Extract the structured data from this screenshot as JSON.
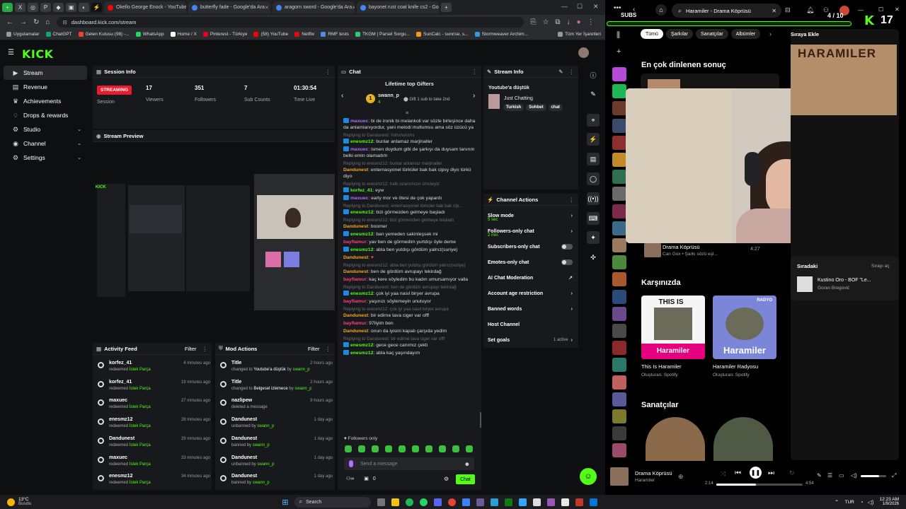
{
  "browser": {
    "tabs": [
      {
        "title": "Okello George Enock - YouTube",
        "color": "#ff0000"
      },
      {
        "title": "butterfly fade - Google'da Ara",
        "color": "#4285f4"
      },
      {
        "title": "aragorn sword - Google'da Ara",
        "color": "#4285f4"
      },
      {
        "title": "bayonet rust coat knife cs2 - Go",
        "color": "#4285f4"
      }
    ],
    "url": "dashboard.kick.com/stream",
    "bookmarks": [
      "Uygulamalar",
      "ChatGPT",
      "Gelen Kutusu (98) -...",
      "WhatsApp",
      "Home / X",
      "Pinterest - Türkiye",
      "(58) YouTube",
      "Netflix",
      "RMF tests",
      "TKGM | Parsel Sorgu...",
      "SunCalc - sunrise, s...",
      "Stormweaver Archim..."
    ],
    "bookmarks_right": "Tüm Yer İşaretleri"
  },
  "kick": {
    "logo": "KICK",
    "sidebar": [
      {
        "label": "Stream",
        "icon": "video-icon",
        "active": true,
        "chev": false
      },
      {
        "label": "Revenue",
        "icon": "wallet-icon",
        "active": false,
        "chev": false
      },
      {
        "label": "Achievements",
        "icon": "trophy-icon",
        "active": false,
        "chev": false
      },
      {
        "label": "Drops & rewards",
        "icon": "gift-icon",
        "active": false,
        "chev": false
      },
      {
        "label": "Studio",
        "icon": "studio-icon",
        "active": false,
        "chev": true
      },
      {
        "label": "Channel",
        "icon": "channel-icon",
        "active": false,
        "chev": true
      },
      {
        "label": "Settings",
        "icon": "gear-icon",
        "active": false,
        "chev": true
      }
    ],
    "session_info": {
      "title": "Session Info",
      "badge": "STREAMING",
      "session_label": "Session",
      "stats": [
        {
          "value": "17",
          "label": "Viewers"
        },
        {
          "value": "351",
          "label": "Followers"
        },
        {
          "value": "7",
          "label": "Sub Counts"
        },
        {
          "value": "01:30:54",
          "label": "Time Live"
        }
      ]
    },
    "stream_preview": {
      "title": "Stream Preview"
    },
    "activity_feed": {
      "title": "Activity Feed",
      "filter": "Filter",
      "items": [
        {
          "user": "korfez_41",
          "action": "redeemed",
          "reward": "İstek Parça",
          "time": "4 minutes ago"
        },
        {
          "user": "korfez_41",
          "action": "redeemed",
          "reward": "İstek Parça",
          "time": "19 minutes ago"
        },
        {
          "user": "maxuec",
          "action": "redeemed",
          "reward": "İstek Parça",
          "time": "27 minutes ago"
        },
        {
          "user": "enesmz12",
          "action": "redeemed",
          "reward": "İstek Parça",
          "time": "28 minutes ago"
        },
        {
          "user": "Dandunest",
          "action": "redeemed",
          "reward": "İstek Parça",
          "time": "29 minutes ago"
        },
        {
          "user": "maxuec",
          "action": "redeemed",
          "reward": "İstek Parça",
          "time": "33 minutes ago"
        },
        {
          "user": "enesmz12",
          "action": "redeemed",
          "reward": "İstek Parça",
          "time": "34 minutes ago"
        }
      ]
    },
    "mod_actions": {
      "title": "Mod Actions",
      "filter": "Filter",
      "items": [
        {
          "title": "Title",
          "detail": "changed to",
          "target": "Youtube'a düştük",
          "by": "by",
          "mod": "swann_p",
          "time": "2 hours ago"
        },
        {
          "title": "Title",
          "detail": "changed to",
          "target": "Belgesel izlemece",
          "by": "by",
          "mod": "swann_p",
          "time": "2 hours ago"
        },
        {
          "title": "nazlipew",
          "detail": "deleted a message",
          "target": "",
          "by": "",
          "mod": "",
          "time": "9 hours ago"
        },
        {
          "title": "Dandunest",
          "detail": "unbanned",
          "target": "",
          "by": "by",
          "mod": "swann_p",
          "time": "1 day ago"
        },
        {
          "title": "Dandunest",
          "detail": "banned",
          "target": "",
          "by": "by",
          "mod": "swann_p",
          "time": "1 day ago"
        },
        {
          "title": "Dandunest",
          "detail": "unbanned",
          "target": "",
          "by": "by",
          "mod": "swann_p",
          "time": "1 day ago"
        },
        {
          "title": "Dandunest",
          "detail": "banned",
          "target": "",
          "by": "by",
          "mod": "swann_p",
          "time": "1 day ago"
        }
      ]
    },
    "chat": {
      "title": "Chat",
      "gifters_title": "Lifetime top Gifters",
      "top_gifter": "swann_p",
      "top_gifter_count": "4",
      "gift_hint": "Gift 1 sub to take 2nd",
      "messages": [
        {
          "reply": "",
          "user": "maxuec",
          "color": "#b46cff",
          "text": "bi de ironik bi melankoli var sözle birleşince daha da anlamlanıyordur, yani melodi mutlumsu ama söz üzücü ya"
        },
        {
          "reply": "Replying to Dandunest: hshshshshs",
          "user": "enesmz12",
          "color": "#53fc18",
          "text": "bunlar anlamaz marjinaller"
        },
        {
          "reply": "",
          "user": "maxuec",
          "color": "#b46cff",
          "text": "ismen duydum gibi de şarkıyı da duysam tanırım belki emin olamadım"
        },
        {
          "reply": "Replying to enesmz12: bunlar anlamaz marjinaller",
          "user": "Dandunest",
          "color": "#f5a623",
          "text": "enternasyonel türküler bak bak cipsy diyo türkü diyo"
        },
        {
          "reply": "Replying to enesmz12: halk ozanımızın izindeyiz",
          "user": "korfez_41",
          "color": "#53fc18",
          "text": "eyw"
        },
        {
          "reply": "",
          "user": "maxuec",
          "color": "#b46cff",
          "text": "early mor ve ötesi de çok yapardı"
        },
        {
          "reply": "Replying to Dandunest: enternasyonel türküler bak bak cip...",
          "user": "enesmz12",
          "color": "#53fc18",
          "text": "bizi görmezden gelmeye başladı"
        },
        {
          "reply": "Replying to enesmz12: bizi görmezden gelmeye başladı",
          "user": "Dandunest",
          "color": "#f5a623",
          "text": "boomer"
        },
        {
          "reply": "",
          "user": "enesmz12",
          "color": "#53fc18",
          "text": "ban yemeden sakinleşsek mi"
        },
        {
          "reply": "",
          "user": "bayflamur",
          "color": "#ff3d7f",
          "text": "yav ben de görmedim yurtdışı öyle deme"
        },
        {
          "reply": "",
          "user": "enesmz12",
          "color": "#53fc18",
          "text": "abla ben yutdışı gördüm yalnız(suriye)"
        },
        {
          "reply": "",
          "user": "Dandunest",
          "color": "#f5a623",
          "text": ""
        },
        {
          "reply": "Replying to enesmz12: abla ben yutdışı gördüm yalnız(suriye)",
          "user": "Dandunest",
          "color": "#f5a623",
          "text": "ben de gördüm avrupayı tekirdağ"
        },
        {
          "reply": "",
          "user": "bayflamur",
          "color": "#ff3d7f",
          "text": "kaç kere söyledim bu kadın umursamıyor valla"
        },
        {
          "reply": "Replying to Dandunest: ben de gördüm avrupayı tekirdağ",
          "user": "enesmz12",
          "color": "#53fc18",
          "text": "çok iyi yaa nasıl biryer avrupa"
        },
        {
          "reply": "",
          "user": "bayflamur",
          "color": "#ff3d7f",
          "text": "yaşınızı söylemeyin unutuyor"
        },
        {
          "reply": "Replying to enesmz12: çok iyi yaa nasıl biryer avrupa",
          "user": "Dandunest",
          "color": "#f5a623",
          "text": "bir edirne tava ciger var offf"
        },
        {
          "reply": "",
          "user": "bayflamur",
          "color": "#ff3d7f",
          "text": "97liyim ben"
        },
        {
          "reply": "",
          "user": "Dandunest",
          "color": "#f5a623",
          "text": "onun da iyisini kapalı çarşıda yedim"
        },
        {
          "reply": "Replying to Dandunest: bir edirne tava ciger var offf",
          "user": "enesmz12",
          "color": "#53fc18",
          "text": "gece gece canımız çekti"
        },
        {
          "reply": "",
          "user": "enesmz12",
          "color": "#53fc18",
          "text": "abla kaç yaşındayım"
        }
      ],
      "followers_only": "Followers only",
      "input_placeholder": "Send a message",
      "footer_count": "0",
      "send_label": "Chat"
    },
    "stream_info": {
      "title": "Stream Info",
      "stream_title": "Youtube'a düştük",
      "category": "Just Chatting",
      "tags": [
        "Turkish",
        "Sohbet",
        "chat"
      ]
    },
    "channel_actions": {
      "title": "Channel Actions",
      "items": [
        {
          "label": "Slow mode",
          "sub": "5 sec",
          "control": "chevron"
        },
        {
          "label": "Followers-only chat",
          "sub": "2 min",
          "control": "chevron"
        },
        {
          "label": "Subscribers-only chat",
          "sub": "",
          "control": "toggle"
        },
        {
          "label": "Emotes-only chat",
          "sub": "",
          "control": "toggle"
        },
        {
          "label": "AI Chat Moderation",
          "sub": "",
          "control": "external"
        },
        {
          "label": "Account age restriction",
          "sub": "",
          "control": "chevron"
        },
        {
          "label": "Banned words",
          "sub": "",
          "control": "chevron"
        },
        {
          "label": "Host Channel",
          "sub": "",
          "control": "none"
        },
        {
          "label": "Set goals",
          "sub": "",
          "control": "chevron",
          "status": "1 active"
        }
      ]
    }
  },
  "spotify": {
    "overlay_subs_label": "SUBS",
    "overlay_subs_value": "4 / 10",
    "overlay_viewers": "17",
    "search_value": "Haramiler - Drama Köprüsü",
    "chips": [
      "Tümü",
      "Şarkılar",
      "Sanatçılar",
      "Albümler"
    ],
    "queue_title": "Sıraya Ekle",
    "album_art_text": "HARAMILER",
    "top_result_heading": "En çok dinlenen sonuç",
    "song_title": "Drama Köprüsü",
    "song_artist": "Can Gox • Şarkı sözü eşl...",
    "song_duration": "4:27",
    "next_heading": "Sıradaki",
    "queue_open": "Sırayı aç",
    "next_title": "Kustino Oro - BOF \"Le...",
    "next_artist": "Goran Bregović",
    "featuring_heading": "Karşınızda",
    "cards": [
      {
        "art_label": "THIS IS",
        "art_name": "Haramiler",
        "title": "This Is Haramiler",
        "sub": "Oluşturan: Spotify"
      },
      {
        "art_label": "RADYO",
        "art_name": "Haramiler",
        "title": "Haramiler Radyosu",
        "sub": "Oluşturan: Spotify"
      }
    ],
    "artists_heading": "Sanatçılar",
    "player_title": "Drama Köprüsü",
    "player_artist": "Haramiler",
    "elapsed": "2:14",
    "total": "4:54",
    "progress": 0.46
  },
  "taskbar": {
    "weather_temp": "13°C",
    "weather_desc": "Bulutlu",
    "search": "Search",
    "lang": "TUR",
    "time": "12:23 AM",
    "date": "1/9/2026"
  },
  "colors": {
    "kick_green": "#53fc18",
    "streaming_red": "#e81c2e",
    "spotify_green": "#1db954"
  }
}
